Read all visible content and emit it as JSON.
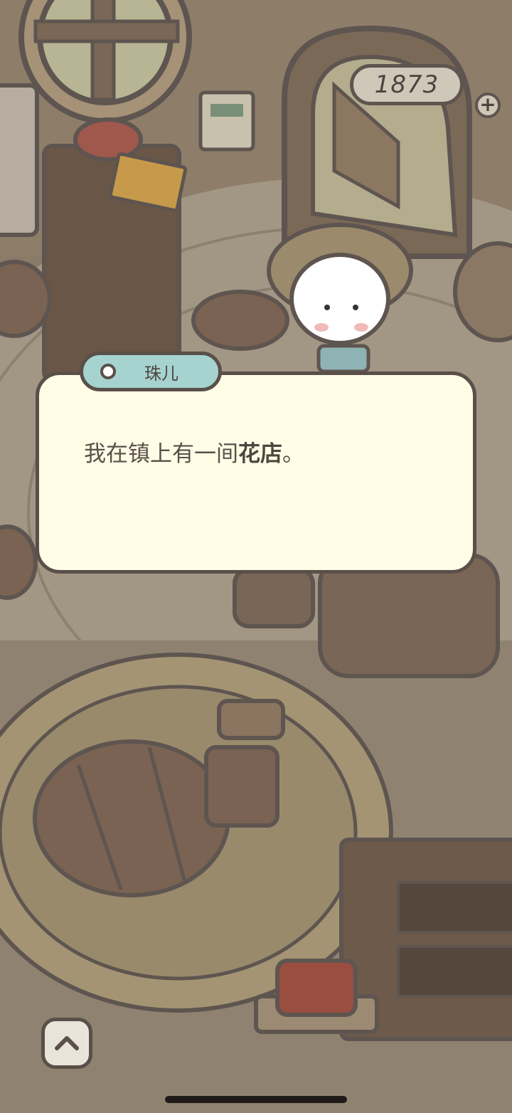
{
  "currency": {
    "amount": "1873",
    "add_icon": "plus-icon",
    "coin_icon": "acorn-icon"
  },
  "dialog": {
    "speaker": "珠儿",
    "line_start": "我在镇上有一间",
    "line_bold": "花店",
    "line_end": "。"
  },
  "controls": {
    "expand_icon": "chevron-up-icon"
  },
  "colors": {
    "dialog_bg": "#fffde6",
    "name_tag": "#a6d3cf",
    "outline": "#5a4f49"
  }
}
